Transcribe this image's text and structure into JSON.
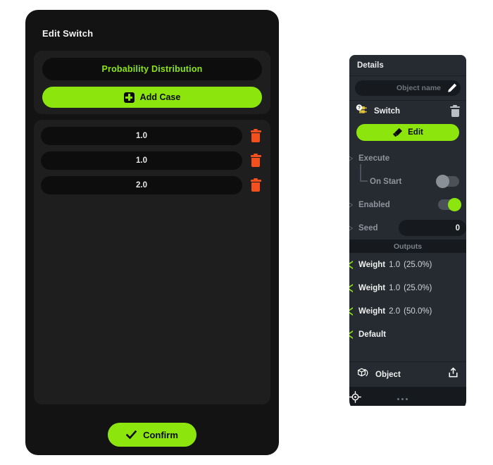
{
  "edit_dialog": {
    "title": "Edit Switch",
    "probability_header": "Probability Distribution",
    "add_case_label": "Add Case",
    "cases": [
      {
        "value": "1.0"
      },
      {
        "value": "1.0"
      },
      {
        "value": "2.0"
      }
    ],
    "confirm_label": "Confirm",
    "accent_color": "#8ce60e",
    "delete_color": "#f4501e"
  },
  "details_panel": {
    "header": "Details",
    "object_name_placeholder": "Object name",
    "object_name_value": "",
    "node_label": "Switch",
    "edit_label": "Edit",
    "properties": [
      {
        "label": "Execute",
        "type": "exec"
      },
      {
        "label": "On Start",
        "type": "toggle",
        "state": "off"
      },
      {
        "label": "Enabled",
        "type": "toggle",
        "state": "on"
      },
      {
        "label": "Seed",
        "type": "number",
        "value": "0"
      }
    ],
    "outputs_header": "Outputs",
    "outputs": [
      {
        "name": "Weight",
        "value": "1.0",
        "percent": "(25.0%)"
      },
      {
        "name": "Weight",
        "value": "1.0",
        "percent": "(25.0%)"
      },
      {
        "name": "Weight",
        "value": "2.0",
        "percent": "(50.0%)"
      },
      {
        "name": "Default",
        "value": "",
        "percent": ""
      }
    ],
    "object_row_label": "Object",
    "accent_color": "#8ce60e",
    "pin_color": "#2fc6d6",
    "node_icon_color": "#e3c33c"
  }
}
